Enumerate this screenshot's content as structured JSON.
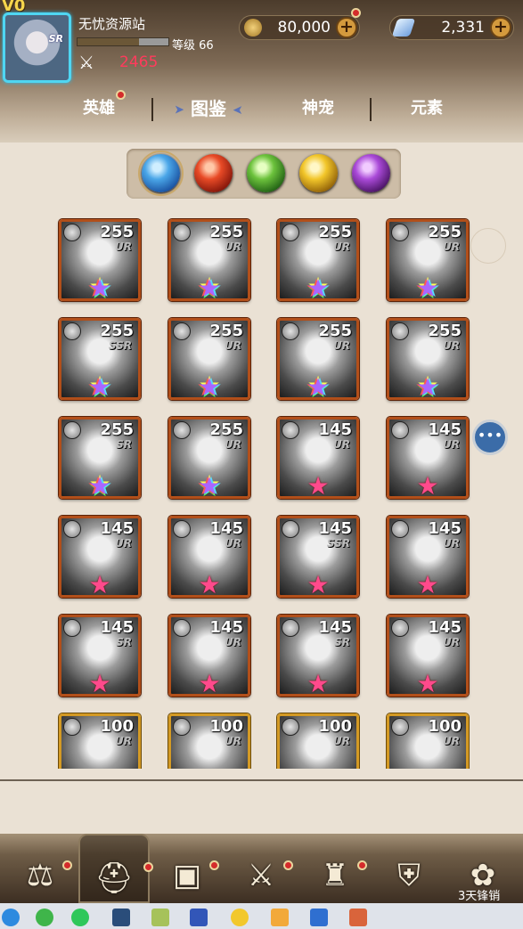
{
  "player": {
    "vip": "V0",
    "name": "无忧资源站",
    "avatar_rarity": "SR",
    "level_label": "等级 66",
    "level_progress": 0.68,
    "power": "2465"
  },
  "currency": {
    "gold": "80,000",
    "gems": "2,331"
  },
  "tabs": [
    {
      "label": "英雄",
      "badge": true
    },
    {
      "label": "图鉴"
    },
    {
      "label": "神宠"
    },
    {
      "label": "元素"
    }
  ],
  "elements": [
    "water-orb-icon",
    "fire-orb-icon",
    "wind-orb-icon",
    "light-orb-icon",
    "dark-orb-icon"
  ],
  "selected_element": "water",
  "heroes": [
    {
      "level": "255",
      "rarity": "UR",
      "star": "rainbow"
    },
    {
      "level": "255",
      "rarity": "UR",
      "star": "rainbow"
    },
    {
      "level": "255",
      "rarity": "UR",
      "star": "rainbow"
    },
    {
      "level": "255",
      "rarity": "UR",
      "star": "rainbow"
    },
    {
      "level": "255",
      "rarity": "SSR",
      "star": "rainbow"
    },
    {
      "level": "255",
      "rarity": "UR",
      "star": "rainbow"
    },
    {
      "level": "255",
      "rarity": "UR",
      "star": "rainbow"
    },
    {
      "level": "255",
      "rarity": "UR",
      "star": "rainbow"
    },
    {
      "level": "255",
      "rarity": "SR",
      "star": "rainbow"
    },
    {
      "level": "255",
      "rarity": "UR",
      "star": "rainbow"
    },
    {
      "level": "145",
      "rarity": "UR",
      "star": "pink"
    },
    {
      "level": "145",
      "rarity": "UR",
      "star": "pink"
    },
    {
      "level": "145",
      "rarity": "UR",
      "star": "pink"
    },
    {
      "level": "145",
      "rarity": "UR",
      "star": "pink"
    },
    {
      "level": "145",
      "rarity": "SSR",
      "star": "pink"
    },
    {
      "level": "145",
      "rarity": "UR",
      "star": "pink"
    },
    {
      "level": "145",
      "rarity": "SR",
      "star": "pink"
    },
    {
      "level": "145",
      "rarity": "UR",
      "star": "pink"
    },
    {
      "level": "145",
      "rarity": "SR",
      "star": "pink"
    },
    {
      "level": "145",
      "rarity": "UR",
      "star": "pink"
    },
    {
      "level": "100",
      "rarity": "UR",
      "star": "none",
      "frame": "gold"
    },
    {
      "level": "100",
      "rarity": "UR",
      "star": "none",
      "frame": "gold"
    },
    {
      "level": "100",
      "rarity": "UR",
      "star": "none",
      "frame": "gold"
    },
    {
      "level": "100",
      "rarity": "UR",
      "star": "none",
      "frame": "gold"
    }
  ],
  "bottom_nav": {
    "items": [
      {
        "icon": "scales-icon",
        "badge": true
      },
      {
        "icon": "helmet-icon",
        "badge": true,
        "active": true
      },
      {
        "icon": "chest-icon",
        "badge": true
      },
      {
        "icon": "crossed-swords-icon",
        "badge": true
      },
      {
        "icon": "tower-icon",
        "badge": true
      },
      {
        "icon": "shield-icon",
        "badge": false
      },
      {
        "icon": "paw-icon",
        "badge": false
      }
    ],
    "overlay_text": "3天锋销"
  }
}
